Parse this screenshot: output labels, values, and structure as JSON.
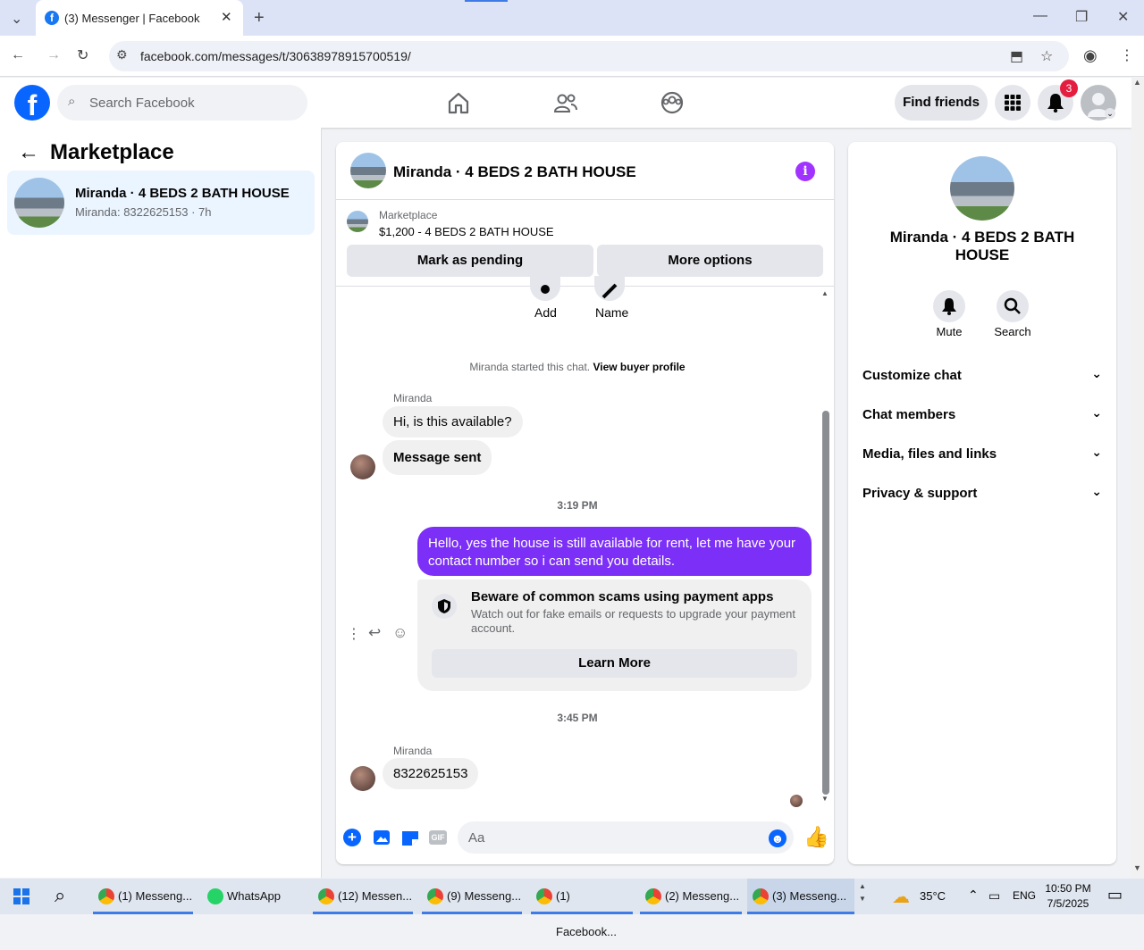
{
  "browser": {
    "tab_title": "(3) Messenger | Facebook",
    "url": "facebook.com/messages/t/30638978915700519/"
  },
  "header": {
    "search_placeholder": "Search Facebook",
    "find_friends": "Find friends",
    "notif_count": "3"
  },
  "sidebar": {
    "title": "Marketplace",
    "conversation": {
      "name": "Miranda · 4 BEDS 2 BATH HOUSE",
      "preview": "Miranda: 8322625153 · 7h"
    }
  },
  "chat": {
    "title": "Miranda · 4 BEDS 2 BATH HOUSE",
    "listing_source": "Marketplace",
    "listing": "$1,200 - 4 BEDS 2 BATH HOUSE",
    "mark_pending": "Mark as pending",
    "more_options": "More options",
    "add_label": "Add",
    "name_label": "Name",
    "started_text": "Miranda started this chat.",
    "view_profile": "View buyer profile",
    "sender1": "Miranda",
    "msg1": "Hi, is this available?",
    "msg2": "Message sent",
    "time1": "3:19 PM",
    "my_msg": "Hello, yes the house is still available for rent, let me have your contact number so i can send you details.",
    "warn_title": "Beware of common scams using payment apps",
    "warn_body": "Watch out for fake emails or requests to upgrade your payment account.",
    "learn_more": "Learn More",
    "time2": "3:45 PM",
    "sender2": "Miranda",
    "msg3": "8322625153",
    "composer_placeholder": "Aa"
  },
  "panel": {
    "name": "Miranda · 4 BEDS 2 BATH HOUSE",
    "mute": "Mute",
    "search": "Search",
    "items": [
      "Customize chat",
      "Chat members",
      "Media, files and links",
      "Privacy & support"
    ]
  },
  "taskbar": {
    "apps": [
      "(1) Messeng...",
      "WhatsApp",
      "(12) Messen...",
      "(9) Messeng...",
      "(1) Facebook...",
      "(2) Messeng...",
      "(3) Messeng..."
    ],
    "temp": "35°C",
    "lang": "ENG",
    "time": "10:50 PM",
    "date": "7/5/2025"
  },
  "colors": {
    "accent": "#0866ff",
    "my_bubble": "#7b2ff7",
    "messenger_purple": "#a033ff"
  }
}
